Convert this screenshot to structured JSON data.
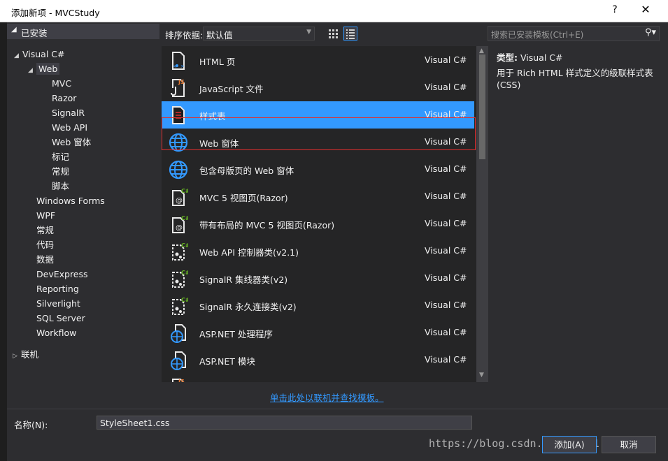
{
  "window": {
    "title": "添加新项 - MVCStudy",
    "help_label": "?",
    "close_label": "✕"
  },
  "left": {
    "installed_label": "已安装",
    "tree": [
      {
        "label": "Visual C#",
        "level": 0,
        "expander": "◢"
      },
      {
        "label": "Web",
        "level": 1,
        "expander": "◢",
        "selected": true
      },
      {
        "label": "MVC",
        "level": 2
      },
      {
        "label": "Razor",
        "level": 2
      },
      {
        "label": "SignalR",
        "level": 2
      },
      {
        "label": "Web API",
        "level": 2
      },
      {
        "label": "Web 窗体",
        "level": 2
      },
      {
        "label": "标记",
        "level": 2
      },
      {
        "label": "常规",
        "level": 2
      },
      {
        "label": "脚本",
        "level": 2
      },
      {
        "label": "Windows Forms",
        "level": 1
      },
      {
        "label": "WPF",
        "level": 1
      },
      {
        "label": "常规",
        "level": 1
      },
      {
        "label": "代码",
        "level": 1
      },
      {
        "label": "数据",
        "level": 1
      },
      {
        "label": "DevExpress",
        "level": 1
      },
      {
        "label": "Reporting",
        "level": 1
      },
      {
        "label": "Silverlight",
        "level": 1
      },
      {
        "label": "SQL Server",
        "level": 1
      },
      {
        "label": "Workflow",
        "level": 1
      }
    ],
    "online_label": "联机"
  },
  "toolbar": {
    "sort_label": "排序依据:",
    "sort_value": "默认值"
  },
  "search": {
    "placeholder": "搜索已安装模板(Ctrl+E)"
  },
  "templates": [
    {
      "name": "HTML 页",
      "lang": "Visual C#",
      "icon": "html-page-icon"
    },
    {
      "name": "JavaScript 文件",
      "lang": "Visual C#",
      "icon": "javascript-file-icon"
    },
    {
      "name": "样式表",
      "lang": "Visual C#",
      "icon": "stylesheet-icon",
      "selected": true
    },
    {
      "name": "Web 窗体",
      "lang": "Visual C#",
      "icon": "globe-icon"
    },
    {
      "name": "包含母版页的 Web 窗体",
      "lang": "Visual C#",
      "icon": "globe-icon"
    },
    {
      "name": "MVC 5 视图页(Razor)",
      "lang": "Visual C#",
      "icon": "razor-view-icon"
    },
    {
      "name": "带有布局的 MVC 5 视图页(Razor)",
      "lang": "Visual C#",
      "icon": "razor-view-icon"
    },
    {
      "name": "Web API 控制器类(v2.1)",
      "lang": "Visual C#",
      "icon": "class-icon"
    },
    {
      "name": "SignalR 集线器类(v2)",
      "lang": "Visual C#",
      "icon": "class-icon"
    },
    {
      "name": "SignalR 永久连接类(v2)",
      "lang": "Visual C#",
      "icon": "class-icon"
    },
    {
      "name": "ASP.NET 处理程序",
      "lang": "Visual C#",
      "icon": "globe-file-icon"
    },
    {
      "name": "ASP.NET 模块",
      "lang": "Visual C#",
      "icon": "globe-file-icon"
    }
  ],
  "description": {
    "type_label": "类型:",
    "type_value": "Visual C#",
    "text": "用于 Rich HTML 样式定义的级联样式表(CSS)"
  },
  "online_link": "单击此处以联机并查找模板。",
  "name_row": {
    "label": "名称(N):",
    "value": "StyleSheet1.css"
  },
  "buttons": {
    "add": "添加(A)",
    "cancel": "取消"
  },
  "watermark": "https://blog.csdn.net/qq_21..15",
  "colors": {
    "accent": "#3399ff",
    "background": "#2d2d30",
    "list_background": "#252526",
    "selection_outline": "#e02f2f"
  }
}
